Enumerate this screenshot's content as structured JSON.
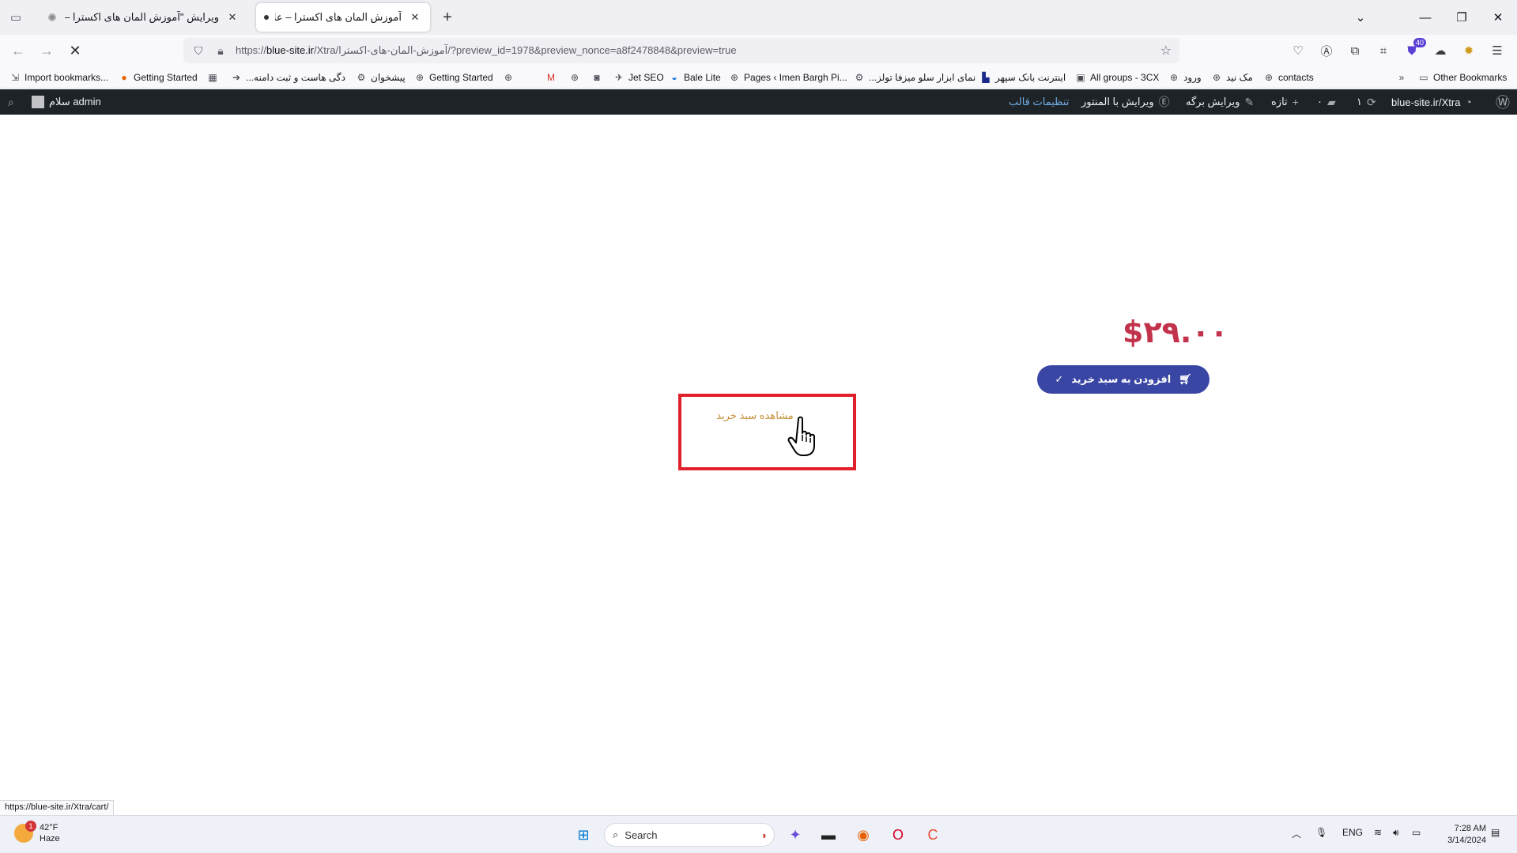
{
  "browser": {
    "tabs": [
      {
        "title": "ویرایش \"آموزش المان های اکسترا – علا",
        "state": "inactive"
      },
      {
        "title": "آموزش المان های اکسترا – علاء",
        "state": "active"
      }
    ],
    "url_prefix": "https://",
    "url_host": "blue-site.ir",
    "url_path": "/Xtra/آموزش-المان-های-اکسترا/?preview_id=1978&preview_nonce=a8f2478848&preview=true",
    "extension_badge": "40"
  },
  "bookmarks": [
    {
      "label": "Import bookmarks...",
      "icon": "import-icon"
    },
    {
      "label": "Getting Started",
      "icon": "firefox-icon"
    },
    {
      "label": "",
      "icon": "calendar-icon"
    },
    {
      "label": "...دگی هاست و ثبت دامنه",
      "icon": "arrow-icon"
    },
    {
      "label": "پیشخوان",
      "icon": "gear-icon"
    },
    {
      "label": "Getting Started",
      "icon": "globe-icon"
    },
    {
      "label": "",
      "icon": "globe-icon"
    },
    {
      "label": "",
      "icon": "gmail-icon"
    },
    {
      "label": "",
      "icon": "globe-icon"
    },
    {
      "label": "",
      "icon": "app-icon"
    },
    {
      "label": "Jet SEO",
      "icon": "rocket-icon"
    },
    {
      "label": "Bale Lite",
      "icon": "bale-icon"
    },
    {
      "label": "Pages ‹ Imen Bargh Pi...",
      "icon": "globe-icon"
    },
    {
      "label": "...نمای ابزار سلو میزفا تولز",
      "icon": "gear-icon"
    },
    {
      "label": "اینترنت بانک سپهر",
      "icon": "bank-icon"
    },
    {
      "label": "All groups - 3CX",
      "icon": "3cx-icon"
    },
    {
      "label": "ورود",
      "icon": "globe-icon"
    },
    {
      "label": "مک نید",
      "icon": "globe-icon"
    },
    {
      "label": "contacts",
      "icon": "globe-icon"
    }
  ],
  "other_bookmarks": "Other Bookmarks",
  "wp_admin": {
    "site": "blue-site.ir/Xtra",
    "updates": "۱",
    "comments": "۰",
    "new": "تازه",
    "edit_page": "ویرایش برگه",
    "edit_elementor": "ویرایش با المنتور",
    "theme_settings": "تنظیمات قالب",
    "greeting": "سلام admin"
  },
  "product": {
    "price": "$۲۹.۰۰",
    "add_to_cart": "افزودن به سبد خرید",
    "view_cart": "مشاهده سبد خرید"
  },
  "status_url": "https://blue-site.ir/Xtra/cart/",
  "taskbar": {
    "temp": "42°F",
    "condition": "Haze",
    "weather_alerts": "1",
    "search_placeholder": "Search",
    "lang": "ENG",
    "time": "7:28 AM",
    "date": "3/14/2024"
  }
}
